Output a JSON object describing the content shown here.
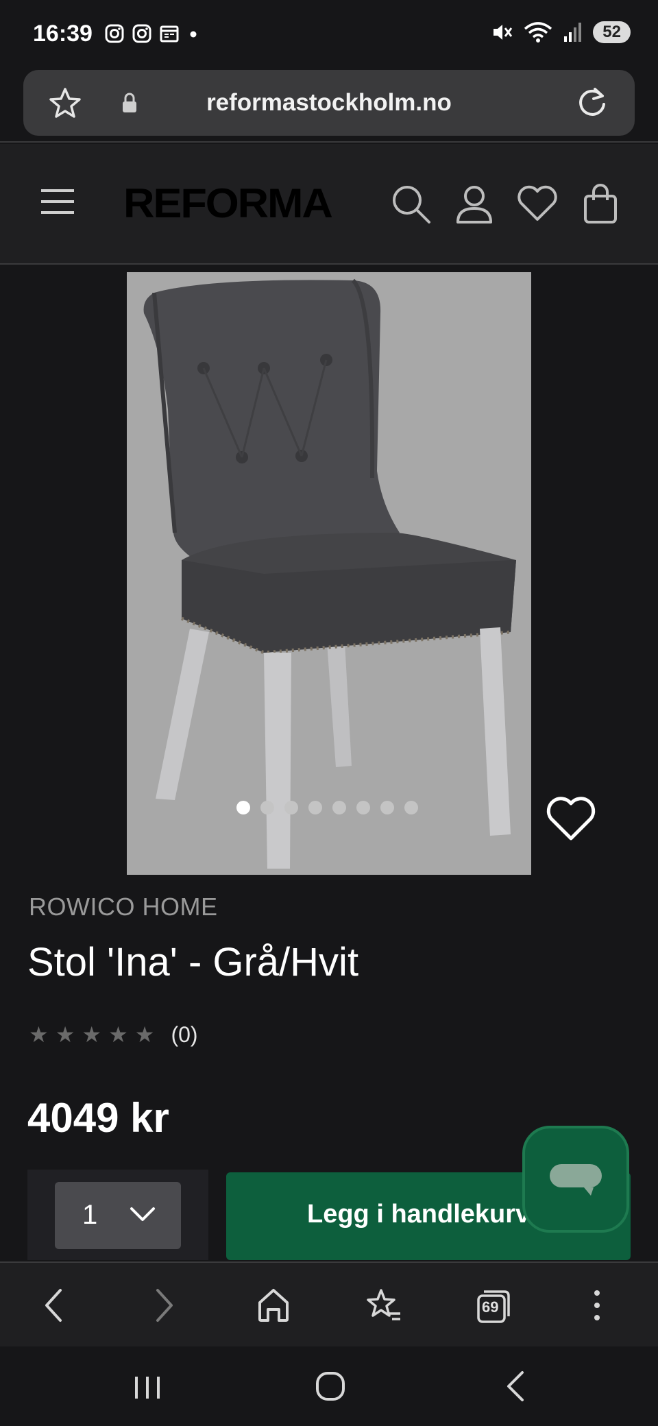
{
  "status_bar": {
    "time": "16:39",
    "battery": "52"
  },
  "browser": {
    "url": "reformastockholm.no",
    "tab_count": "69"
  },
  "site": {
    "logo": "REFORMA"
  },
  "product": {
    "brand": "ROWICO HOME",
    "title": "Stol 'Ina' - Grå/Hvit",
    "rating_count": "(0)",
    "rating_value": 0,
    "rating_max": 5,
    "price": "4049 kr",
    "quantity": "1",
    "add_to_cart_label": "Legg i handlekurven",
    "image_count": 8,
    "active_image": 1
  },
  "colors": {
    "accent": "#0d5f3d",
    "background": "#161618",
    "header": "#1f1f21"
  }
}
